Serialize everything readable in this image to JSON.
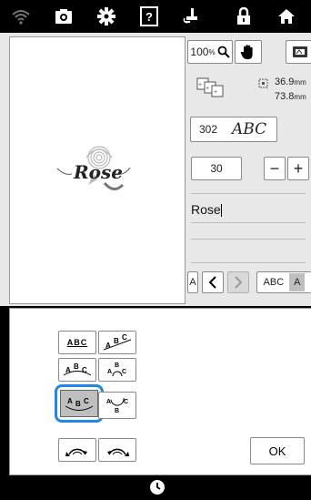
{
  "topbar": {
    "icons": [
      "wifi-icon",
      "camera-icon",
      "settings-icon",
      "help-icon",
      "presser-foot-icon",
      "lock-icon",
      "home-icon"
    ],
    "help_glyph": "?"
  },
  "view": {
    "zoom_value": "100",
    "zoom_unit": "%",
    "width_value": "36.9",
    "height_value": "73.8",
    "unit": "mm"
  },
  "font": {
    "number": "302",
    "sample": "ABC"
  },
  "size": {
    "value": "30",
    "minus": "−",
    "plus": "+"
  },
  "text_input": {
    "value": "Rose"
  },
  "nav": {
    "char_label": "A",
    "prev": "<",
    "next": ">",
    "case_label": "ABC",
    "case_alt": "A"
  },
  "preview": {
    "text": "Rose"
  },
  "arrangement": {
    "label": "ABC",
    "selected_index": 4
  },
  "ok_label": "OK"
}
